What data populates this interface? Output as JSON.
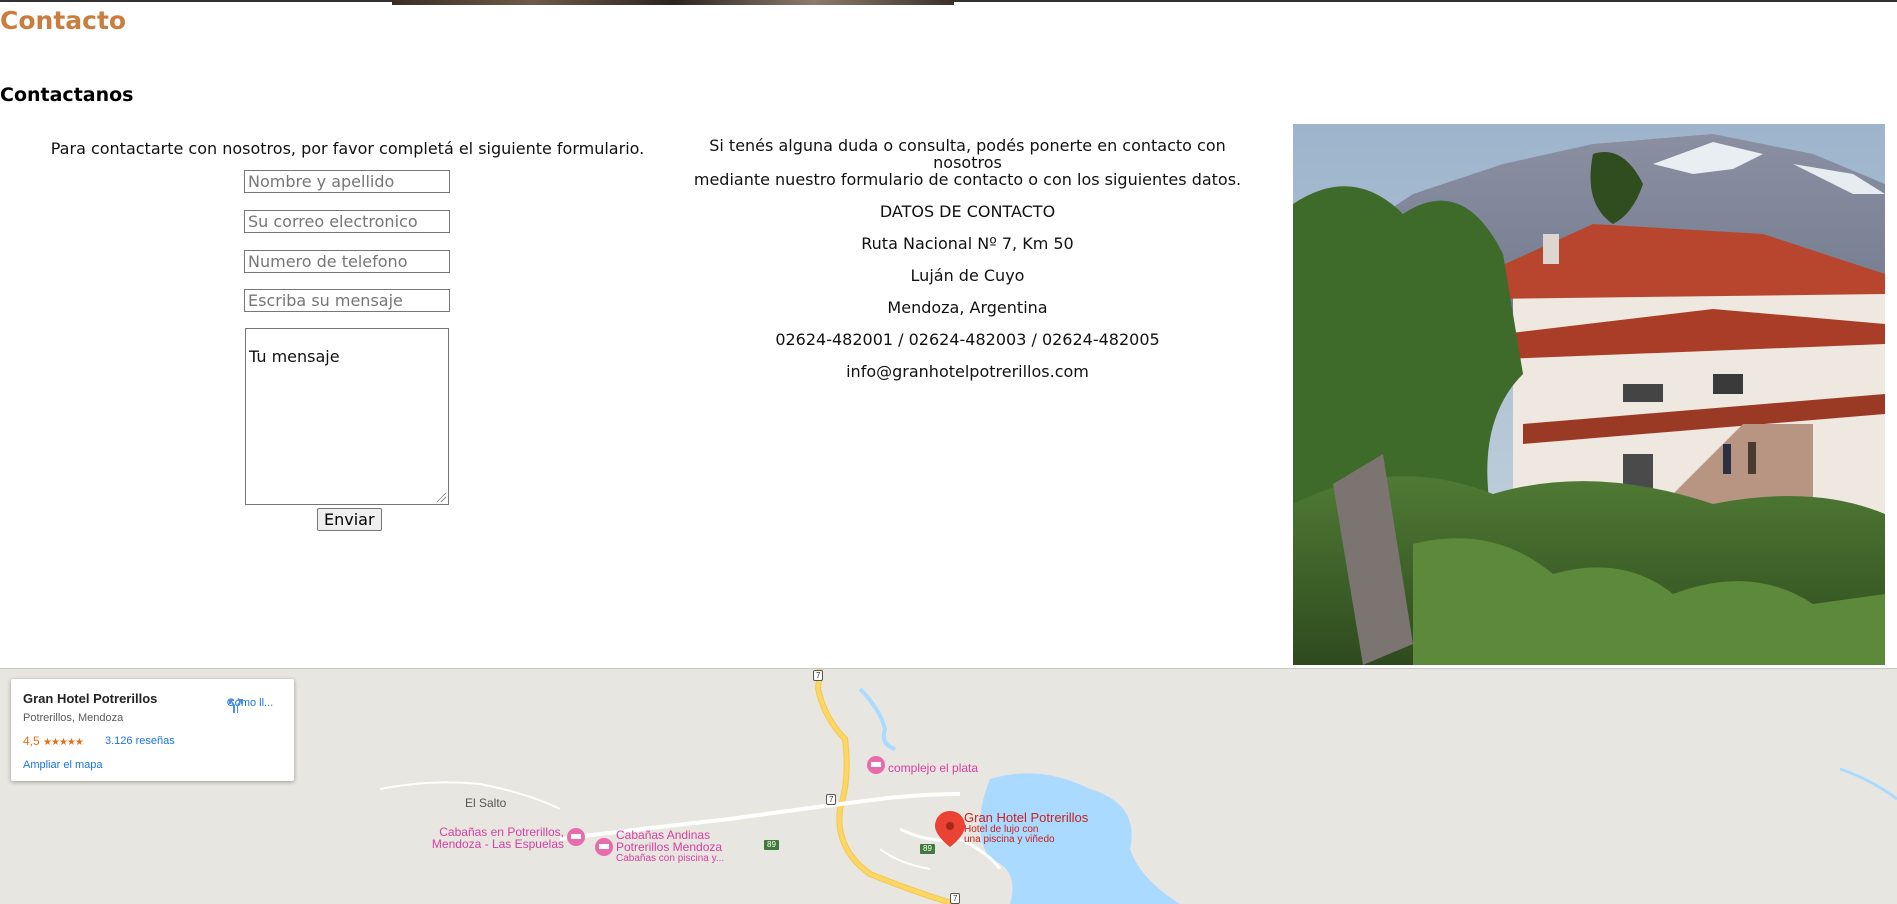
{
  "page": {
    "title": "Contacto",
    "subtitle": "Contactanos"
  },
  "form": {
    "intro": "Para contactarte con nosotros, por favor completá el siguiente formulario.",
    "name_placeholder": "Nombre y apellido",
    "email_placeholder": "Su correo electronico",
    "phone_placeholder": "Numero de telefono",
    "subject_placeholder": "Escriba su mensaje",
    "message_value": "Tu mensaje",
    "submit_label": "Enviar"
  },
  "contact": {
    "intro_line1": "Si tenés alguna duda o consulta, podés ponerte en contacto con nosotros",
    "intro_line2": "mediante nuestro formulario de contacto o con los siguientes datos.",
    "heading": "DATOS DE CONTACTO",
    "address": "Ruta Nacional Nº 7, Km 50",
    "city": "Luján de Cuyo",
    "region": "Mendoza, Argentina",
    "phones": "02624-482001 / 02624-482003 / 02624-482005",
    "email": "info@granhotelpotrerillos.com"
  },
  "map": {
    "card": {
      "name": "Gran Hotel Potrerillos",
      "location": "Potrerillos, Mendoza",
      "rating": "4,5",
      "stars": "★★★★★",
      "reviews": "3.126 reseñas",
      "directions_label": "Cómo ll...",
      "enlarge_label": "Ampliar el mapa"
    },
    "places": {
      "complejo": "complejo el plata",
      "el_salto": "El Salto",
      "cabanas1_l1": "Cabañas en Potrerillos,",
      "cabanas1_l2": "Mendoza - Las Espuelas",
      "cabanas2_l1": "Cabañas Andinas",
      "cabanas2_l2": "Potrerillos Mendoza",
      "cabanas2_l3": "Cabañas con piscina y...",
      "hotel": "Gran Hotel Potrerillos",
      "hotel_desc1": "Hotel de lujo con",
      "hotel_desc2": "una piscina y viñedo"
    },
    "roads": {
      "r7_top": "7",
      "r7_mid": "7",
      "r7_bottom": "7",
      "r89_a": "89",
      "r89_b": "89"
    },
    "colors": {
      "water": "#aadaff",
      "land": "#e8e6e1",
      "road": "#fdd663",
      "marker": "#ea4335",
      "poi": "#d6409f"
    }
  },
  "colors": {
    "title": "#c97d3e"
  }
}
